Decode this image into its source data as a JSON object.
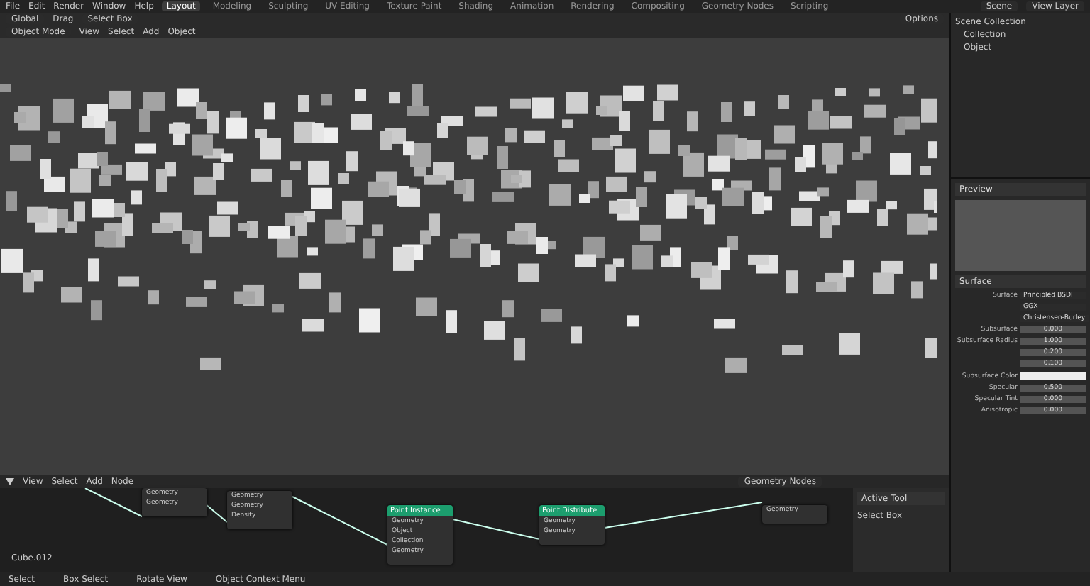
{
  "menu": [
    "File",
    "Edit",
    "Render",
    "Window",
    "Help"
  ],
  "workspaces": [
    {
      "label": "Layout",
      "selected": true
    },
    {
      "label": "Modeling",
      "selected": false
    },
    {
      "label": "Sculpting",
      "selected": false
    },
    {
      "label": "UV Editing",
      "selected": false
    },
    {
      "label": "Texture Paint",
      "selected": false
    },
    {
      "label": "Shading",
      "selected": false
    },
    {
      "label": "Animation",
      "selected": false
    },
    {
      "label": "Rendering",
      "selected": false
    },
    {
      "label": "Compositing",
      "selected": false
    },
    {
      "label": "Geometry Nodes",
      "selected": false
    },
    {
      "label": "Scripting",
      "selected": false
    }
  ],
  "scene": "Scene",
  "view_layer": "View Layer",
  "viewport": {
    "orientation": "Global",
    "drag": "Drag",
    "select": "Select Box",
    "options": "Options",
    "mode": "Object Mode",
    "menus": [
      "View",
      "Select",
      "Add",
      "Object"
    ]
  },
  "outliner": {
    "items": [
      {
        "name": "Scene Collection",
        "children": [
          {
            "name": "Collection"
          },
          {
            "name": "Object"
          }
        ]
      }
    ]
  },
  "properties": {
    "preview": "Preview",
    "surface": "Surface",
    "rows": [
      {
        "kind": "dropdown",
        "label": "Surface",
        "value": "Principled BSDF"
      },
      {
        "kind": "dropdown",
        "value": "GGX"
      },
      {
        "kind": "dropdown",
        "value": "Christensen-Burley"
      },
      {
        "kind": "number",
        "label": "Subsurface",
        "value": "0.000"
      },
      {
        "kind": "number",
        "label": "Subsurface Radius",
        "value": "1.000"
      },
      {
        "kind": "number",
        "value": "0.200"
      },
      {
        "kind": "number",
        "value": "0.100"
      },
      {
        "kind": "color",
        "label": "Subsurface Color"
      },
      {
        "kind": "number",
        "label": "Specular",
        "value": "0.500"
      },
      {
        "kind": "number",
        "label": "Specular Tint",
        "value": "0.000"
      },
      {
        "kind": "number",
        "label": "Anisotropic",
        "value": "0.000"
      }
    ]
  },
  "node_editor": {
    "menus": [
      "View",
      "Select",
      "Add",
      "Node"
    ],
    "tree": "Geometry Nodes",
    "object": "Cube.012",
    "nodes": [
      {
        "header": false,
        "sockets": [
          "Geometry",
          "Geometry"
        ]
      },
      {
        "header": false,
        "sockets": [
          "Geometry",
          "Geometry",
          "Density"
        ]
      },
      {
        "title": "Point Instance",
        "header": true,
        "sockets": [
          "Geometry",
          "Object",
          "Collection",
          "Geometry"
        ]
      },
      {
        "title": "Point Distribute",
        "header": true,
        "sockets": [
          "Geometry",
          "Geometry"
        ]
      },
      {
        "header": false,
        "sockets": [
          "Geometry"
        ]
      }
    ],
    "sidebar": {
      "title": "Active Tool",
      "tool": "Select Box"
    }
  },
  "status_bar": [
    "Select",
    "Box Select",
    "Rotate View",
    "Object Context Menu"
  ]
}
